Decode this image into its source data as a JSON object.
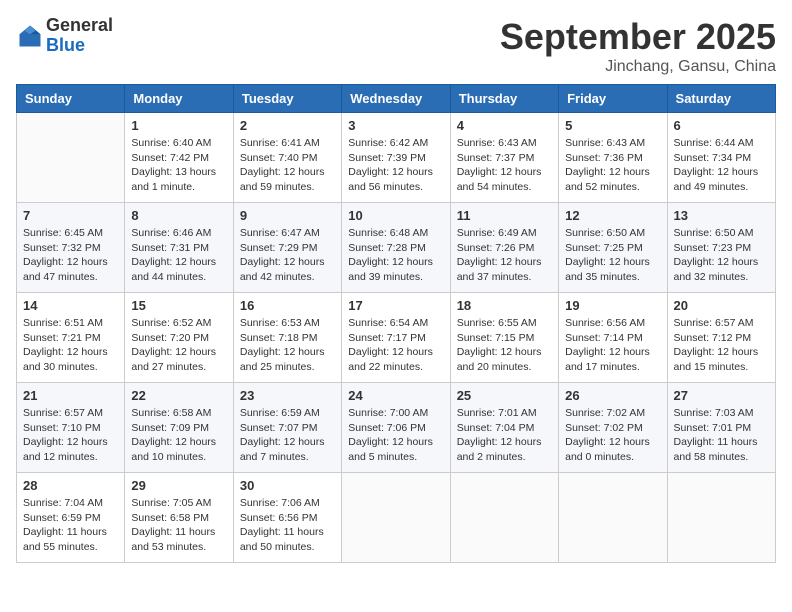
{
  "logo": {
    "general": "General",
    "blue": "Blue"
  },
  "title": {
    "month": "September 2025",
    "location": "Jinchang, Gansu, China"
  },
  "weekdays": [
    "Sunday",
    "Monday",
    "Tuesday",
    "Wednesday",
    "Thursday",
    "Friday",
    "Saturday"
  ],
  "weeks": [
    [
      {
        "day": "",
        "info": ""
      },
      {
        "day": "1",
        "info": "Sunrise: 6:40 AM\nSunset: 7:42 PM\nDaylight: 13 hours\nand 1 minute."
      },
      {
        "day": "2",
        "info": "Sunrise: 6:41 AM\nSunset: 7:40 PM\nDaylight: 12 hours\nand 59 minutes."
      },
      {
        "day": "3",
        "info": "Sunrise: 6:42 AM\nSunset: 7:39 PM\nDaylight: 12 hours\nand 56 minutes."
      },
      {
        "day": "4",
        "info": "Sunrise: 6:43 AM\nSunset: 7:37 PM\nDaylight: 12 hours\nand 54 minutes."
      },
      {
        "day": "5",
        "info": "Sunrise: 6:43 AM\nSunset: 7:36 PM\nDaylight: 12 hours\nand 52 minutes."
      },
      {
        "day": "6",
        "info": "Sunrise: 6:44 AM\nSunset: 7:34 PM\nDaylight: 12 hours\nand 49 minutes."
      }
    ],
    [
      {
        "day": "7",
        "info": "Sunrise: 6:45 AM\nSunset: 7:32 PM\nDaylight: 12 hours\nand 47 minutes."
      },
      {
        "day": "8",
        "info": "Sunrise: 6:46 AM\nSunset: 7:31 PM\nDaylight: 12 hours\nand 44 minutes."
      },
      {
        "day": "9",
        "info": "Sunrise: 6:47 AM\nSunset: 7:29 PM\nDaylight: 12 hours\nand 42 minutes."
      },
      {
        "day": "10",
        "info": "Sunrise: 6:48 AM\nSunset: 7:28 PM\nDaylight: 12 hours\nand 39 minutes."
      },
      {
        "day": "11",
        "info": "Sunrise: 6:49 AM\nSunset: 7:26 PM\nDaylight: 12 hours\nand 37 minutes."
      },
      {
        "day": "12",
        "info": "Sunrise: 6:50 AM\nSunset: 7:25 PM\nDaylight: 12 hours\nand 35 minutes."
      },
      {
        "day": "13",
        "info": "Sunrise: 6:50 AM\nSunset: 7:23 PM\nDaylight: 12 hours\nand 32 minutes."
      }
    ],
    [
      {
        "day": "14",
        "info": "Sunrise: 6:51 AM\nSunset: 7:21 PM\nDaylight: 12 hours\nand 30 minutes."
      },
      {
        "day": "15",
        "info": "Sunrise: 6:52 AM\nSunset: 7:20 PM\nDaylight: 12 hours\nand 27 minutes."
      },
      {
        "day": "16",
        "info": "Sunrise: 6:53 AM\nSunset: 7:18 PM\nDaylight: 12 hours\nand 25 minutes."
      },
      {
        "day": "17",
        "info": "Sunrise: 6:54 AM\nSunset: 7:17 PM\nDaylight: 12 hours\nand 22 minutes."
      },
      {
        "day": "18",
        "info": "Sunrise: 6:55 AM\nSunset: 7:15 PM\nDaylight: 12 hours\nand 20 minutes."
      },
      {
        "day": "19",
        "info": "Sunrise: 6:56 AM\nSunset: 7:14 PM\nDaylight: 12 hours\nand 17 minutes."
      },
      {
        "day": "20",
        "info": "Sunrise: 6:57 AM\nSunset: 7:12 PM\nDaylight: 12 hours\nand 15 minutes."
      }
    ],
    [
      {
        "day": "21",
        "info": "Sunrise: 6:57 AM\nSunset: 7:10 PM\nDaylight: 12 hours\nand 12 minutes."
      },
      {
        "day": "22",
        "info": "Sunrise: 6:58 AM\nSunset: 7:09 PM\nDaylight: 12 hours\nand 10 minutes."
      },
      {
        "day": "23",
        "info": "Sunrise: 6:59 AM\nSunset: 7:07 PM\nDaylight: 12 hours\nand 7 minutes."
      },
      {
        "day": "24",
        "info": "Sunrise: 7:00 AM\nSunset: 7:06 PM\nDaylight: 12 hours\nand 5 minutes."
      },
      {
        "day": "25",
        "info": "Sunrise: 7:01 AM\nSunset: 7:04 PM\nDaylight: 12 hours\nand 2 minutes."
      },
      {
        "day": "26",
        "info": "Sunrise: 7:02 AM\nSunset: 7:02 PM\nDaylight: 12 hours\nand 0 minutes."
      },
      {
        "day": "27",
        "info": "Sunrise: 7:03 AM\nSunset: 7:01 PM\nDaylight: 11 hours\nand 58 minutes."
      }
    ],
    [
      {
        "day": "28",
        "info": "Sunrise: 7:04 AM\nSunset: 6:59 PM\nDaylight: 11 hours\nand 55 minutes."
      },
      {
        "day": "29",
        "info": "Sunrise: 7:05 AM\nSunset: 6:58 PM\nDaylight: 11 hours\nand 53 minutes."
      },
      {
        "day": "30",
        "info": "Sunrise: 7:06 AM\nSunset: 6:56 PM\nDaylight: 11 hours\nand 50 minutes."
      },
      {
        "day": "",
        "info": ""
      },
      {
        "day": "",
        "info": ""
      },
      {
        "day": "",
        "info": ""
      },
      {
        "day": "",
        "info": ""
      }
    ]
  ]
}
